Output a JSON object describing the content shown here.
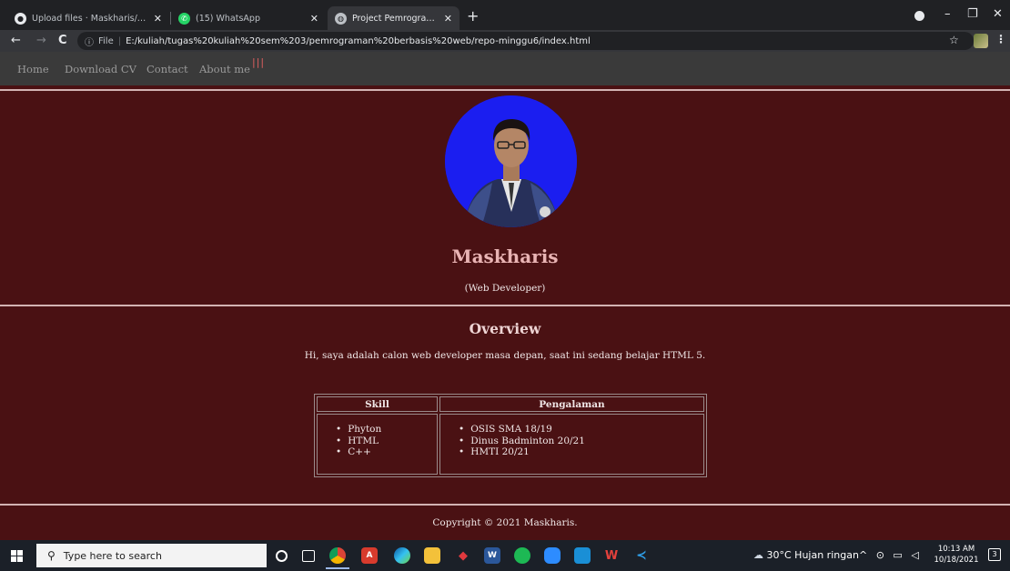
{
  "browser": {
    "tabs": [
      {
        "title": "Upload files · Maskharis/pemrog",
        "icon": "github-icon",
        "active": false
      },
      {
        "title": "(15) WhatsApp",
        "icon": "whatsapp-icon",
        "active": false
      },
      {
        "title": "Project Pemrograman Website",
        "icon": "globe-icon",
        "active": true
      }
    ],
    "new_tab_glyph": "+",
    "close_glyph": "✕",
    "address": {
      "scheme": "File",
      "url": "E:/kuliah/tugas%20kuliah%20sem%203/pemrograman%20berbasis%20web/repo-minggu6/index.html"
    },
    "nav_glyphs": {
      "back": "←",
      "forward": "→",
      "reload": "C",
      "info": "ⓘ"
    },
    "window_glyphs": {
      "minimize": "–",
      "restore": "❐",
      "close": "✕"
    },
    "star_glyph": "☆",
    "menu_glyph": "⋮"
  },
  "site": {
    "nav": [
      "Home",
      "Download CV",
      "Contact",
      "About me"
    ],
    "hamburger": "|||",
    "name": "Maskharis",
    "role": "(Web Developer)",
    "overview_title": "Overview",
    "overview_text": "Hi, saya adalah calon web developer masa depan, saat ini sedang belajar HTML 5.",
    "table": {
      "headers": [
        "Skill",
        "Pengalaman"
      ],
      "skills": [
        "Phyton",
        "HTML",
        "C++"
      ],
      "experience": [
        "OSIS SMA 18/19",
        "Dinus Badminton 20/21",
        "HMTI 20/21"
      ]
    },
    "footer": "Copyright © 2021 Maskharis.",
    "colors": {
      "background": "#4a1113",
      "name": "#e9b4b4",
      "avatar_bg": "#1b1ef0"
    }
  },
  "taskbar": {
    "search_placeholder": "Type here to search",
    "weather": "30°C  Hujan ringan",
    "time": "10:13 AM",
    "date": "10/18/2021",
    "notification_count": "3",
    "app_icons": [
      "cortana-icon",
      "task-view-icon",
      "chrome-icon",
      "acrobat-icon",
      "edge-icon",
      "file-explorer-icon",
      "ruby-icon",
      "word-icon",
      "spotify-icon",
      "zoom-icon",
      "mail-icon",
      "wps-icon",
      "vscode-icon"
    ]
  }
}
